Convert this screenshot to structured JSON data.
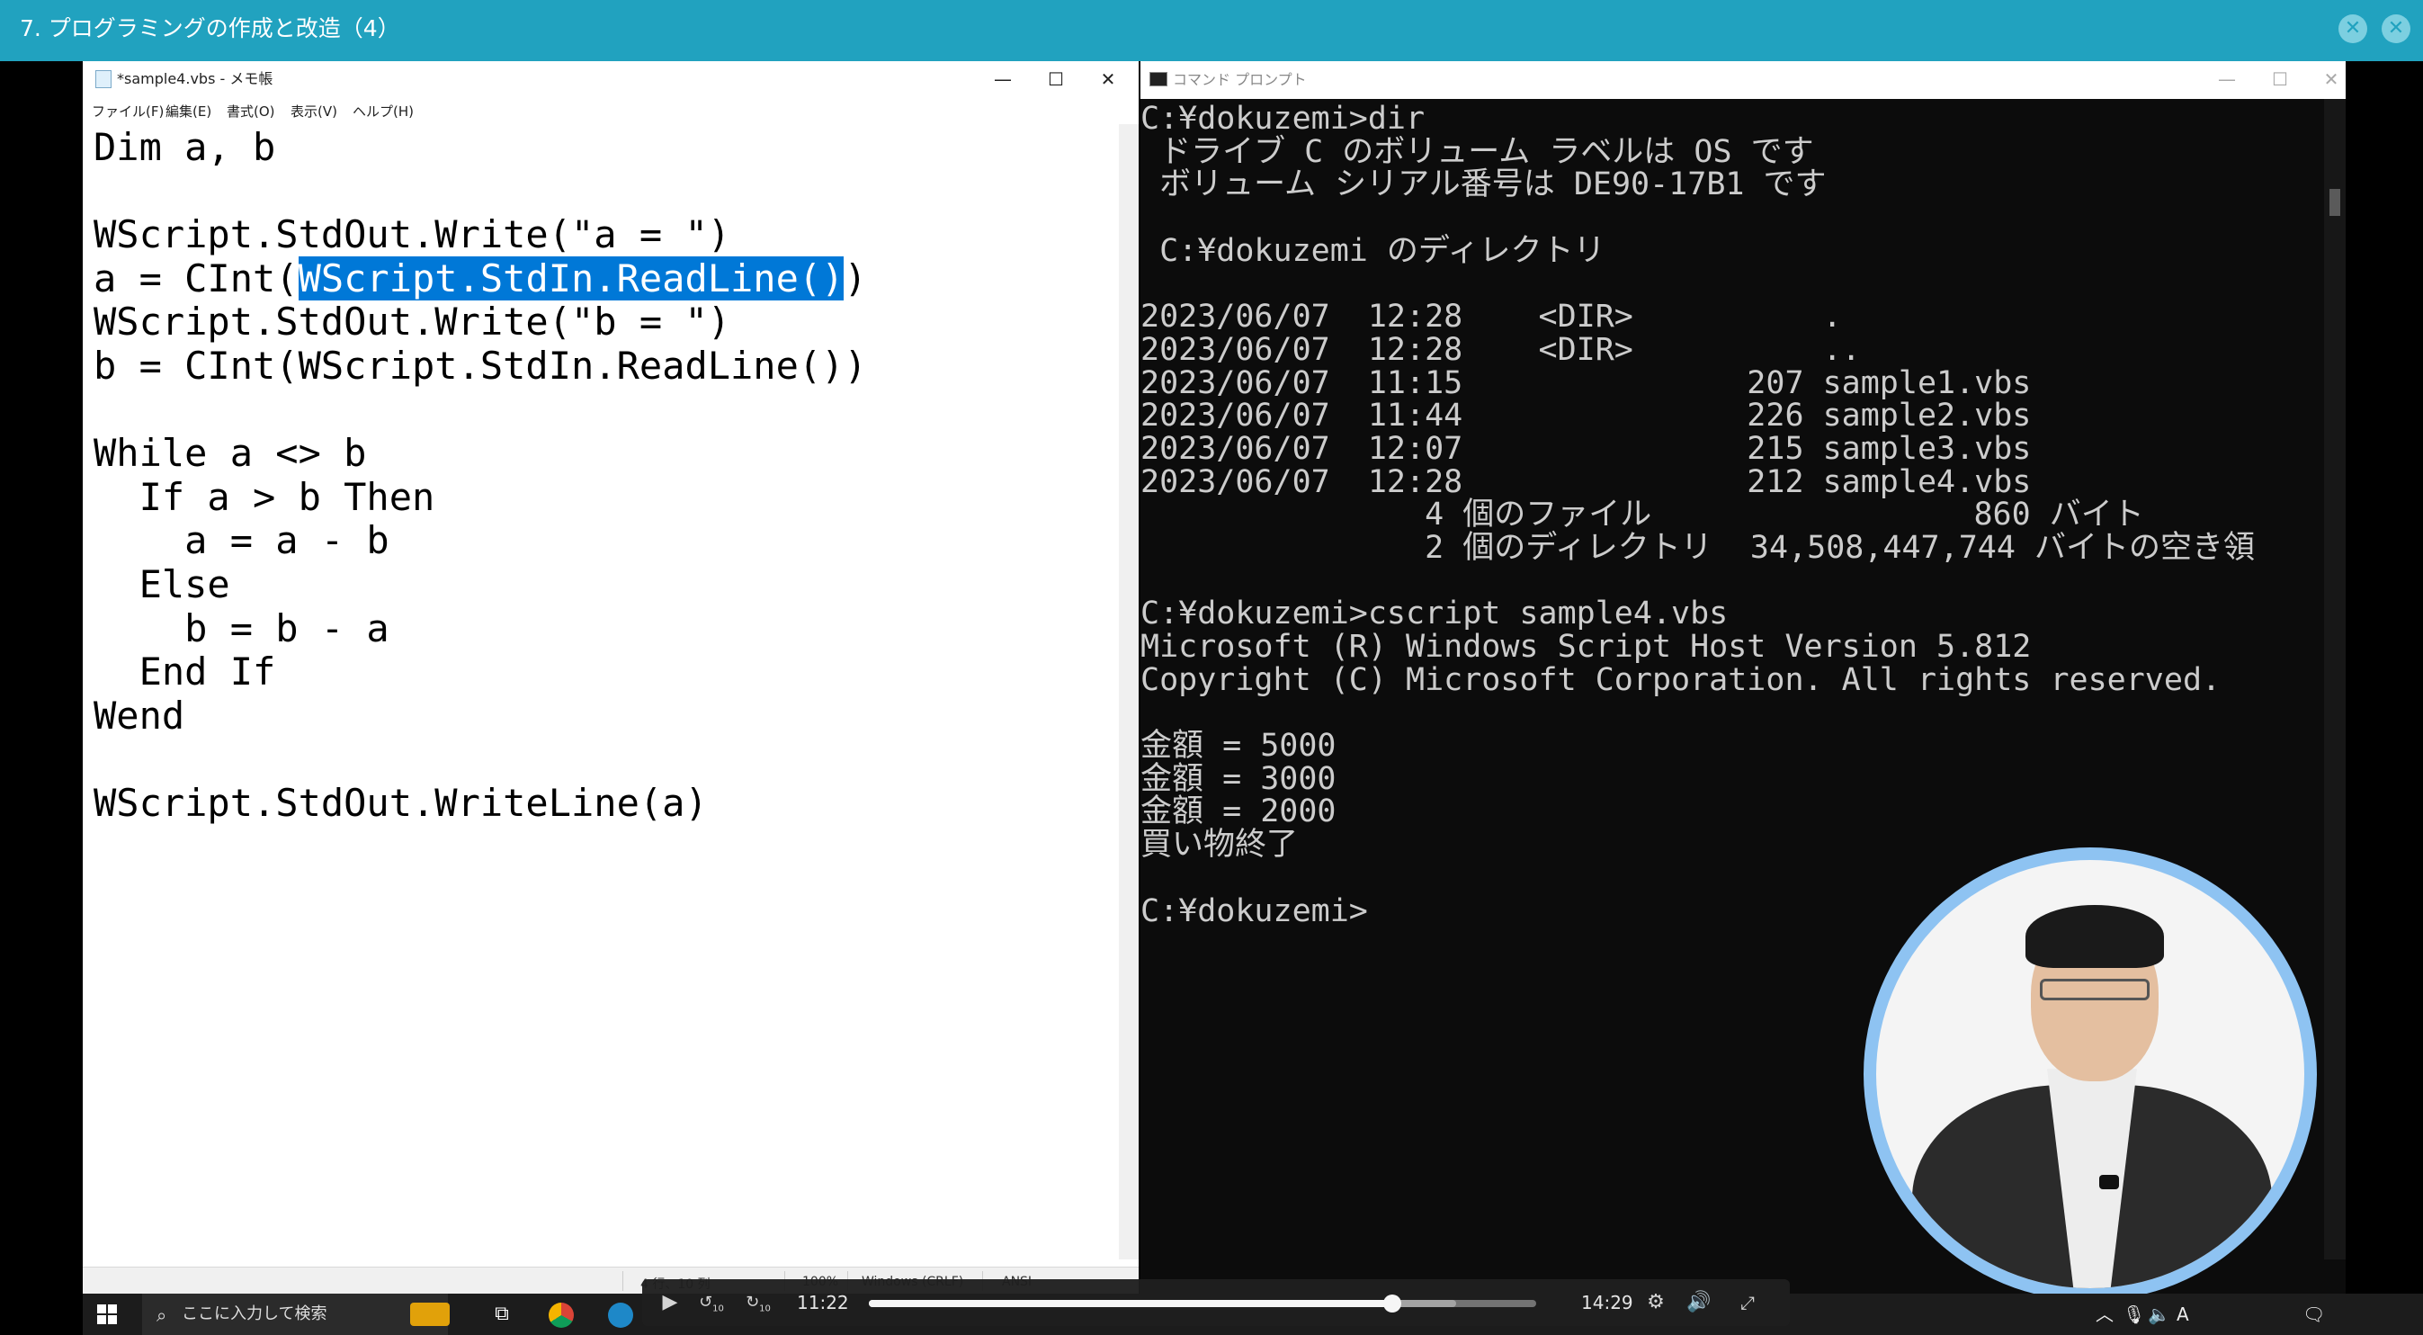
{
  "course": {
    "title": "7. プログラミングの作成と改造（4）"
  },
  "notepad": {
    "title": "*sample4.vbs - メモ帳",
    "menu": [
      "ファイル(F)",
      "編集(E)",
      "書式(O)",
      "表示(V)",
      "ヘルプ(H)"
    ],
    "code_lines": [
      "Dim a, b",
      "",
      "WScript.StdOut.Write(\"a = \")",
      "",
      "WScript.StdOut.Write(\"b = \")",
      "b = CInt(WScript.StdIn.ReadLine())",
      "",
      "While a <> b",
      "  If a > b Then",
      "    a = a - b",
      "  Else",
      "    b = b - a",
      "  End If",
      "Wend",
      "",
      "WScript.StdOut.WriteLine(a)"
    ],
    "selected_line": {
      "before": "a = CInt(",
      "selected": "WScript.StdIn.ReadLine()",
      "after": ")"
    },
    "status": {
      "position": "4 行、10 列",
      "zoom": "100%",
      "line_ending": "Windows (CRLF)",
      "encoding": "ANSI"
    }
  },
  "cmd": {
    "title": "コマンド プロンプト",
    "lines": [
      "C:¥dokuzemi>dir",
      " ドライブ C のボリューム ラベルは OS です",
      " ボリューム シリアル番号は DE90-17B1 です",
      "",
      " C:¥dokuzemi のディレクトリ",
      "",
      "2023/06/07  12:28    <DIR>          .",
      "2023/06/07  12:28    <DIR>          ..",
      "2023/06/07  11:15               207 sample1.vbs",
      "2023/06/07  11:44               226 sample2.vbs",
      "2023/06/07  12:07               215 sample3.vbs",
      "2023/06/07  12:28               212 sample4.vbs",
      "               4 個のファイル                 860 バイト",
      "               2 個のディレクトリ  34,508,447,744 バイトの空き領",
      "",
      "C:¥dokuzemi>cscript sample4.vbs",
      "Microsoft (R) Windows Script Host Version 5.812",
      "Copyright (C) Microsoft Corporation. All rights reserved.",
      "",
      "金額 = 5000",
      "金額 = 3000",
      "金額 = 2000",
      "買い物終了",
      "",
      "C:¥dokuzemi>"
    ]
  },
  "player": {
    "current_time": "11:22",
    "duration": "14:29",
    "progress": 0.785,
    "buffered": 0.88,
    "rewind_label": "10",
    "forward_label": "10"
  },
  "taskbar": {
    "search_placeholder": "ここに入力して検索",
    "ime_label": "A"
  },
  "colors": {
    "course_bar": "#21a2bf",
    "selection": "#0078d7",
    "cmd_background": "#0c0c0c",
    "webcam_ring": "#8ec3f2"
  }
}
